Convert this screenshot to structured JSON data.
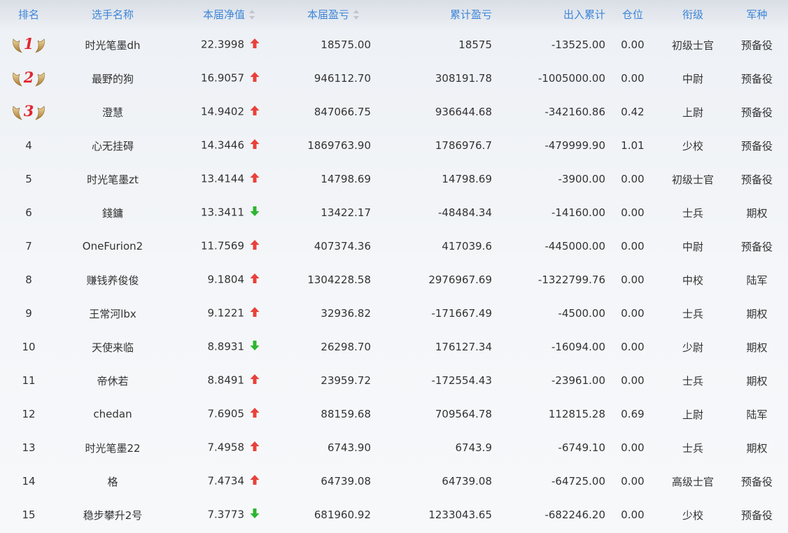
{
  "headers": {
    "rank": "排名",
    "name": "选手名称",
    "nav": "本届净值",
    "pl": "本届盈亏",
    "cum_pl": "累计盈亏",
    "flow": "出入累计",
    "position": "仓位",
    "title": "衔级",
    "branch": "军种"
  },
  "colors": {
    "header_text": "#3d85d8",
    "up_arrow": "#e8413b",
    "down_arrow": "#2db52f",
    "medal_rank": "#e0262f"
  },
  "rows": [
    {
      "rank": "1",
      "name": "时光笔墨dh",
      "nav": "22.3998",
      "trend": "up",
      "pl": "18575.00",
      "cum_pl": "18575",
      "flow": "-13525.00",
      "position": "0.00",
      "title": "初级士官",
      "branch": "预备役"
    },
    {
      "rank": "2",
      "name": "最野的狗",
      "nav": "16.9057",
      "trend": "up",
      "pl": "946112.70",
      "cum_pl": "308191.78",
      "flow": "-1005000.00",
      "position": "0.00",
      "title": "中尉",
      "branch": "预备役"
    },
    {
      "rank": "3",
      "name": "澄慧",
      "nav": "14.9402",
      "trend": "up",
      "pl": "847066.75",
      "cum_pl": "936644.68",
      "flow": "-342160.86",
      "position": "0.42",
      "title": "上尉",
      "branch": "预备役"
    },
    {
      "rank": "4",
      "name": "心无挂碍",
      "nav": "14.3446",
      "trend": "up",
      "pl": "1869763.90",
      "cum_pl": "1786976.7",
      "flow": "-479999.90",
      "position": "1.01",
      "title": "少校",
      "branch": "预备役"
    },
    {
      "rank": "5",
      "name": "时光笔墨zt",
      "nav": "13.4144",
      "trend": "up",
      "pl": "14798.69",
      "cum_pl": "14798.69",
      "flow": "-3900.00",
      "position": "0.00",
      "title": "初级士官",
      "branch": "预备役"
    },
    {
      "rank": "6",
      "name": "錢鏞",
      "nav": "13.3411",
      "trend": "down",
      "pl": "13422.17",
      "cum_pl": "-48484.34",
      "flow": "-14160.00",
      "position": "0.00",
      "title": "士兵",
      "branch": "期权"
    },
    {
      "rank": "7",
      "name": "OneFurion2",
      "nav": "11.7569",
      "trend": "up",
      "pl": "407374.36",
      "cum_pl": "417039.6",
      "flow": "-445000.00",
      "position": "0.00",
      "title": "中尉",
      "branch": "预备役"
    },
    {
      "rank": "8",
      "name": "赚钱养俊俊",
      "nav": "9.1804",
      "trend": "up",
      "pl": "1304228.58",
      "cum_pl": "2976967.69",
      "flow": "-1322799.76",
      "position": "0.00",
      "title": "中校",
      "branch": "陆军"
    },
    {
      "rank": "9",
      "name": "王常河lbx",
      "nav": "9.1221",
      "trend": "up",
      "pl": "32936.82",
      "cum_pl": "-171667.49",
      "flow": "-4500.00",
      "position": "0.00",
      "title": "士兵",
      "branch": "期权"
    },
    {
      "rank": "10",
      "name": "天使来临",
      "nav": "8.8931",
      "trend": "down",
      "pl": "26298.70",
      "cum_pl": "176127.34",
      "flow": "-16094.00",
      "position": "0.00",
      "title": "少尉",
      "branch": "期权"
    },
    {
      "rank": "11",
      "name": "帝休若",
      "nav": "8.8491",
      "trend": "up",
      "pl": "23959.72",
      "cum_pl": "-172554.43",
      "flow": "-23961.00",
      "position": "0.00",
      "title": "士兵",
      "branch": "期权"
    },
    {
      "rank": "12",
      "name": "chedan",
      "nav": "7.6905",
      "trend": "up",
      "pl": "88159.68",
      "cum_pl": "709564.78",
      "flow": "112815.28",
      "position": "0.69",
      "title": "上尉",
      "branch": "陆军"
    },
    {
      "rank": "13",
      "name": "时光笔墨22",
      "nav": "7.4958",
      "trend": "up",
      "pl": "6743.90",
      "cum_pl": "6743.9",
      "flow": "-6749.10",
      "position": "0.00",
      "title": "士兵",
      "branch": "期权"
    },
    {
      "rank": "14",
      "name": "格",
      "nav": "7.4734",
      "trend": "up",
      "pl": "64739.08",
      "cum_pl": "64739.08",
      "flow": "-64725.00",
      "position": "0.00",
      "title": "高级士官",
      "branch": "预备役"
    },
    {
      "rank": "15",
      "name": "稳步攀升2号",
      "nav": "7.3773",
      "trend": "down",
      "pl": "681960.92",
      "cum_pl": "1233043.65",
      "flow": "-682246.20",
      "position": "0.00",
      "title": "少校",
      "branch": "预备役"
    }
  ]
}
